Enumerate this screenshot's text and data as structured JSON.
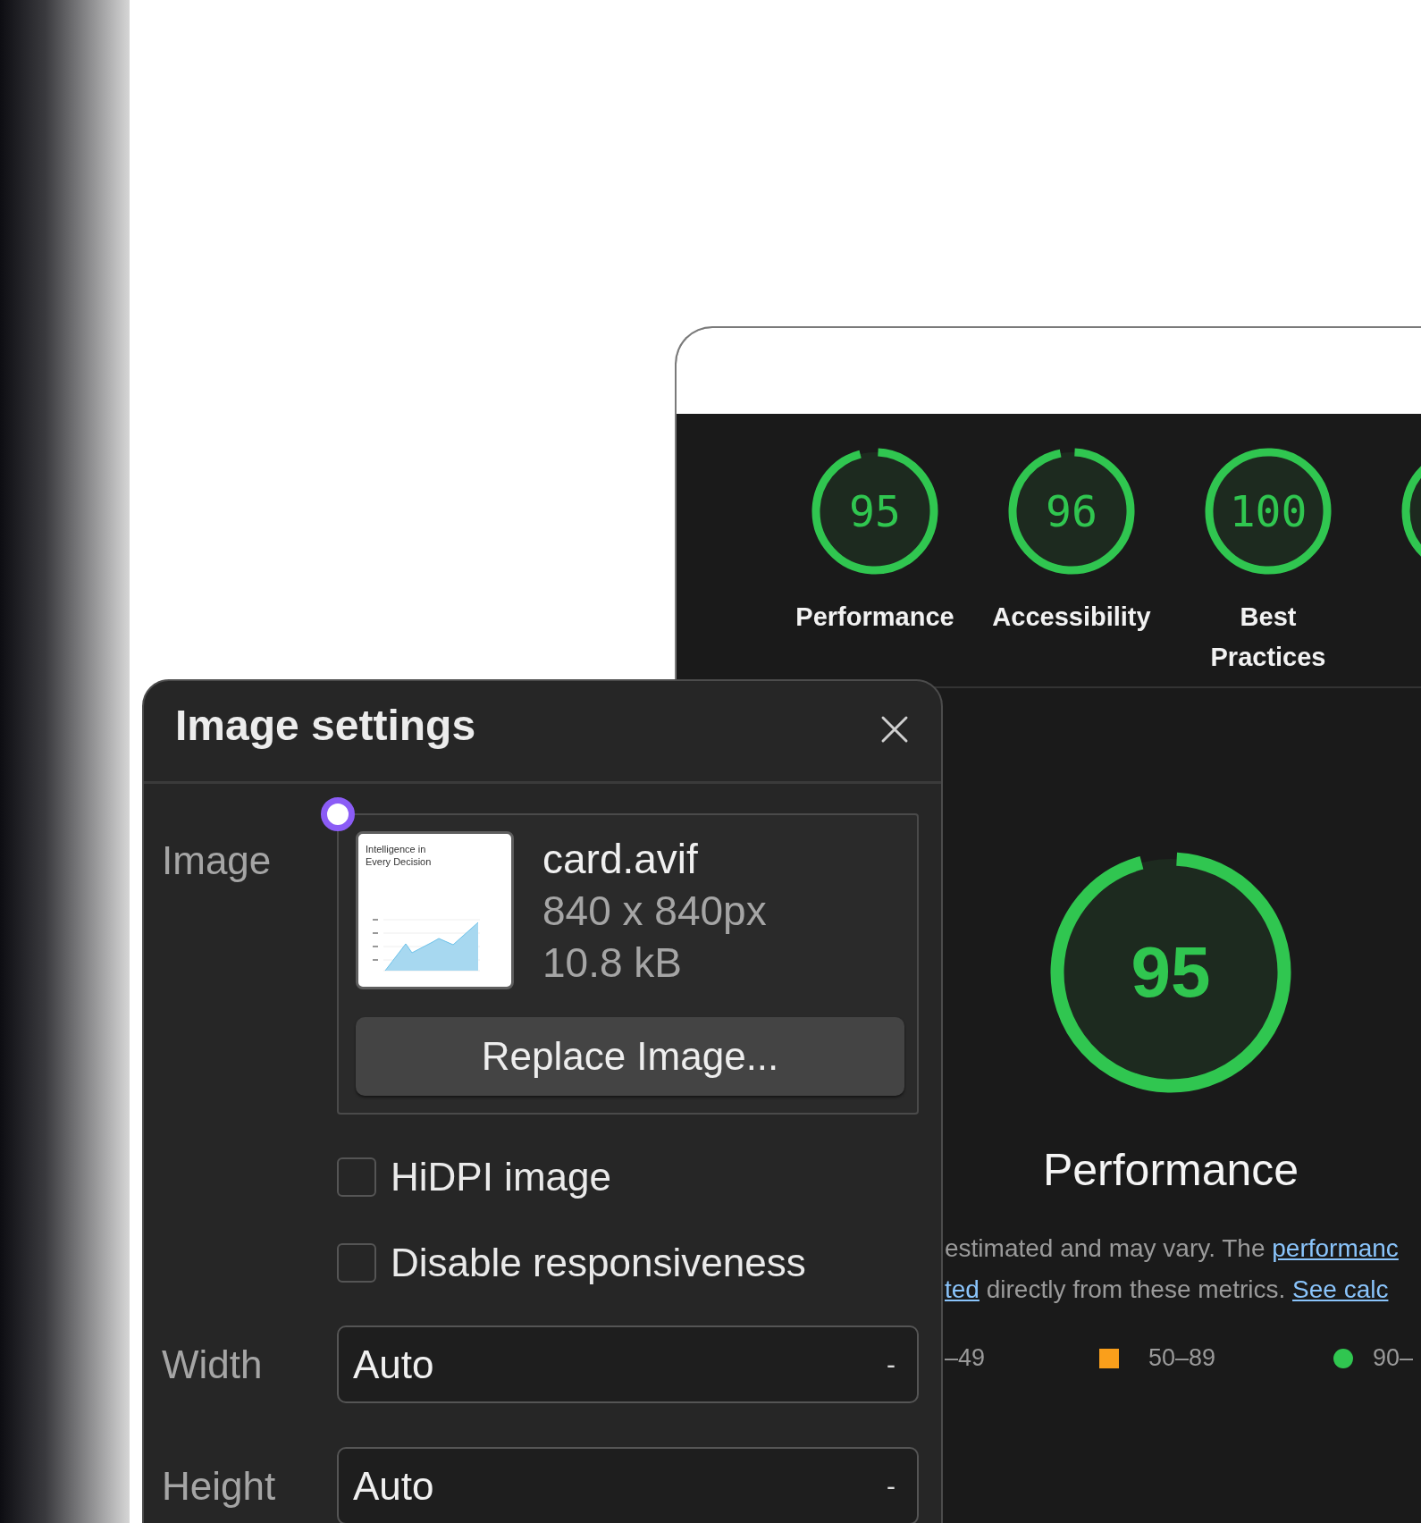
{
  "report": {
    "categories": [
      {
        "score": "95",
        "label": "Performance",
        "level": 0.95
      },
      {
        "score": "96",
        "label": "Accessibility",
        "level": 0.96
      },
      {
        "score": "100",
        "label": "Best Practices",
        "level": 1
      }
    ],
    "headline": {
      "score": "95",
      "label": "Performance",
      "level": 0.95
    },
    "description": [
      {
        "parts": [
          {
            "text": "estimated and may vary. The ",
            "link": false
          },
          {
            "text": "performanc",
            "link": true
          }
        ]
      },
      {
        "parts": [
          {
            "text": "ted",
            "link": true
          },
          {
            "text": " directly from these metrics. ",
            "link": false
          },
          {
            "text": "See calc",
            "link": true
          }
        ]
      }
    ],
    "legend": [
      {
        "range": "–49"
      },
      {
        "range": "50–89",
        "kind": "square",
        "color": "#fa9f1b"
      },
      {
        "range": "90–",
        "kind": "circle",
        "color": "#30c650"
      }
    ]
  },
  "dialog": {
    "title": "Image settings",
    "image_label": "Image",
    "file": {
      "name": "card.avif",
      "dimensions": "840 x 840px",
      "size": "10.8 kB",
      "thumbnail_title": "Intelligence in Every Decision"
    },
    "replace_button": "Replace Image...",
    "options": [
      {
        "label": "HiDPI image",
        "checked": false
      },
      {
        "label": "Disable responsiveness",
        "checked": false
      }
    ],
    "fields": [
      {
        "label": "Width",
        "value": "Auto",
        "suffix": "-"
      },
      {
        "label": "Height",
        "value": "Auto",
        "suffix": "-"
      }
    ]
  }
}
